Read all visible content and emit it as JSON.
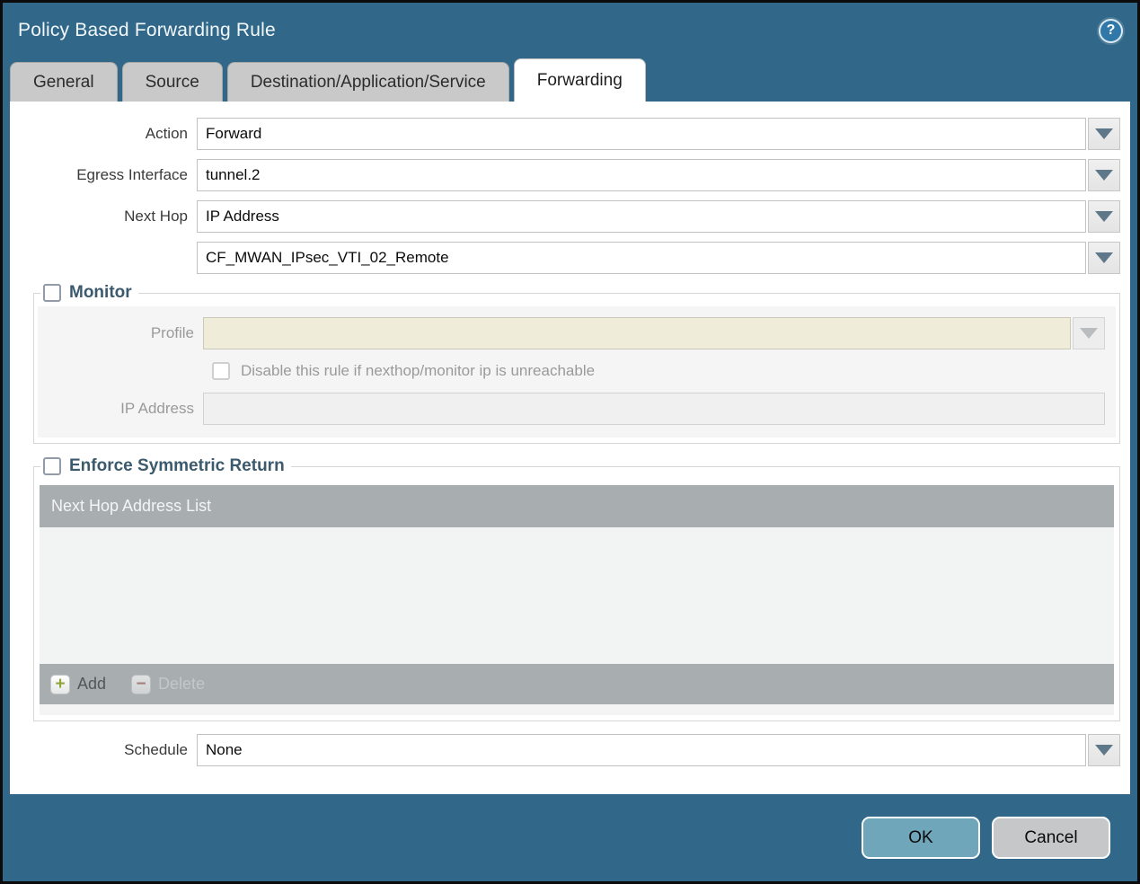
{
  "dialog": {
    "title": "Policy Based Forwarding Rule",
    "help_glyph": "?"
  },
  "tabs": [
    {
      "label": "General",
      "active": false
    },
    {
      "label": "Source",
      "active": false
    },
    {
      "label": "Destination/Application/Service",
      "active": false
    },
    {
      "label": "Forwarding",
      "active": true
    }
  ],
  "form": {
    "action": {
      "label": "Action",
      "value": "Forward"
    },
    "egress_interface": {
      "label": "Egress Interface",
      "value": "tunnel.2"
    },
    "next_hop": {
      "label": "Next Hop",
      "value": "IP Address"
    },
    "next_hop_address": {
      "value": "CF_MWAN_IPsec_VTI_02_Remote"
    },
    "monitor": {
      "label": "Monitor",
      "checked": false,
      "profile": {
        "label": "Profile",
        "value": ""
      },
      "disable_rule": {
        "label": "Disable this rule if nexthop/monitor ip is unreachable",
        "checked": false
      },
      "ip_address": {
        "label": "IP Address",
        "value": ""
      }
    },
    "enforce_symmetric_return": {
      "label": "Enforce Symmetric Return",
      "checked": false,
      "table": {
        "header": "Next Hop Address List",
        "rows": [],
        "add_label": "Add",
        "delete_label": "Delete"
      }
    },
    "schedule": {
      "label": "Schedule",
      "value": "None"
    }
  },
  "footer": {
    "ok_label": "OK",
    "cancel_label": "Cancel"
  },
  "icons": {
    "help": "question-mark-circle",
    "dropdown": "chevron-down-triangle",
    "add": "plus-badge",
    "delete": "minus-badge"
  },
  "colors": {
    "titlebar_bg": "#31688a",
    "tab_inactive_bg": "#c9c9c9",
    "tab_active_bg": "#ffffff",
    "legend_text": "#3c5a6d",
    "table_header_bg": "#a8adb0",
    "profile_field_bg": "#f0ecda",
    "disabled_panel_bg": "#f5f5f6",
    "dropdown_arrow": "#5e7889",
    "add_plus": "#8fa43b",
    "delete_minus": "#a1665e",
    "ok_button_bg": "#6fa6ba",
    "cancel_button_bg": "#c5c7c9"
  }
}
